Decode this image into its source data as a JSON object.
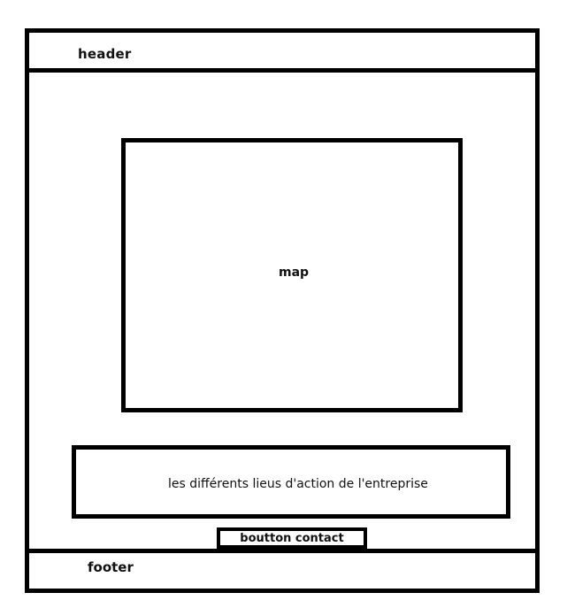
{
  "header": {
    "label": "header"
  },
  "map": {
    "label": "map"
  },
  "places": {
    "label": "les différents lieus d'action de l'entreprise"
  },
  "contact_button": {
    "label": "boutton contact"
  },
  "footer": {
    "label": "footer"
  }
}
